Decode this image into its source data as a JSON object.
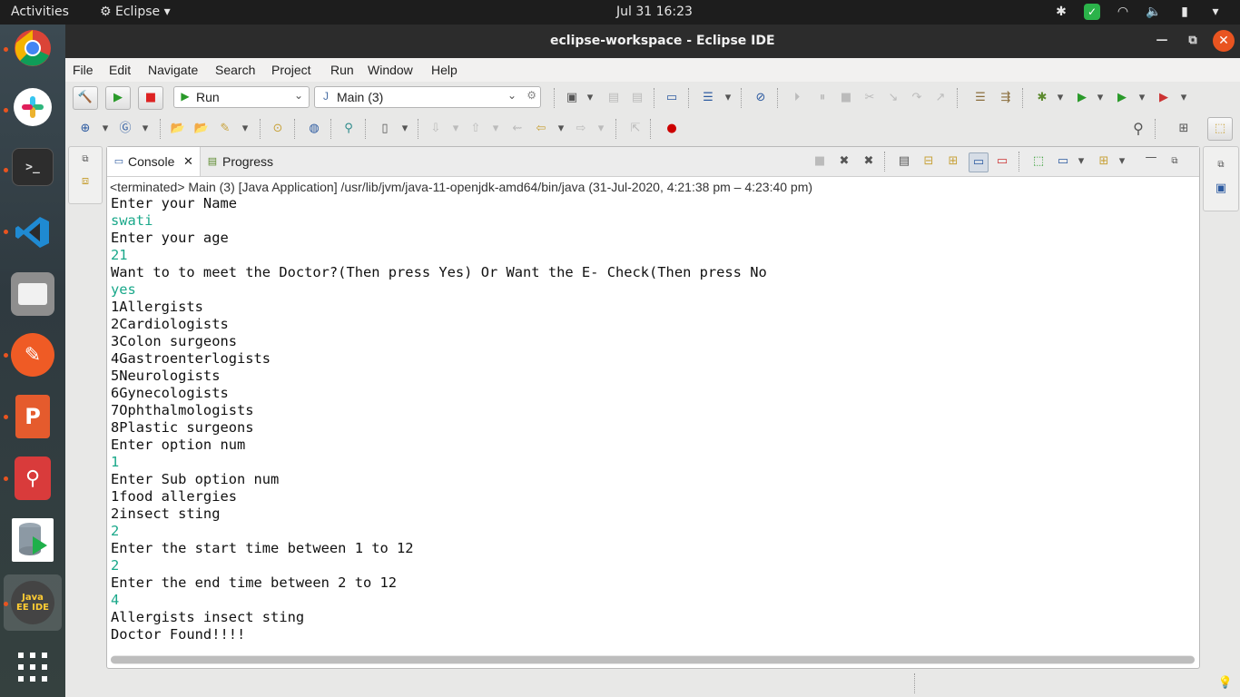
{
  "topbar": {
    "activities": "Activities",
    "app_menu": "Eclipse",
    "clock": "Jul 31  16:23"
  },
  "dock": {
    "apps": [
      "chrome",
      "slack",
      "terminal",
      "vscode",
      "files",
      "postman",
      "presentation",
      "wps",
      "database",
      "eclipse-javaee",
      "app-grid"
    ],
    "eclipse_label": "Java EE IDE"
  },
  "window": {
    "title": "eclipse-workspace - Eclipse IDE"
  },
  "menu": [
    "File",
    "Edit",
    "Navigate",
    "Search",
    "Project",
    "Run",
    "Window",
    "Help"
  ],
  "toolbar": {
    "run_combo": "Run",
    "config_combo": "Main (3)"
  },
  "view": {
    "tabs": [
      {
        "label": "Console",
        "active": true,
        "closable": true
      },
      {
        "label": "Progress",
        "active": false,
        "closable": false
      }
    ],
    "launch_info": "<terminated> Main (3) [Java Application] /usr/lib/jvm/java-11-openjdk-amd64/bin/java  (31-Jul-2020, 4:21:38 pm – 4:23:40 pm)",
    "console_lines": [
      {
        "text": "Enter your Name",
        "input": false
      },
      {
        "text": "swati",
        "input": true
      },
      {
        "text": "Enter your age",
        "input": false
      },
      {
        "text": "21",
        "input": true
      },
      {
        "text": "Want to to meet the Doctor?(Then press Yes) Or Want the E- Check(Then press No",
        "input": false
      },
      {
        "text": "yes",
        "input": true
      },
      {
        "text": "1Allergists",
        "input": false
      },
      {
        "text": "2Cardiologists",
        "input": false
      },
      {
        "text": "3Colon surgeons",
        "input": false
      },
      {
        "text": "4Gastroenterlogists",
        "input": false
      },
      {
        "text": "5Neurologists",
        "input": false
      },
      {
        "text": "6Gynecologists",
        "input": false
      },
      {
        "text": "7Ophthalmologists",
        "input": false
      },
      {
        "text": "8Plastic surgeons",
        "input": false
      },
      {
        "text": "Enter option num",
        "input": false
      },
      {
        "text": "1",
        "input": true
      },
      {
        "text": "Enter Sub option num",
        "input": false
      },
      {
        "text": "1food allergies",
        "input": false
      },
      {
        "text": "2insect sting",
        "input": false
      },
      {
        "text": "2",
        "input": true
      },
      {
        "text": "Enter the start time between 1 to 12",
        "input": false
      },
      {
        "text": "2",
        "input": true
      },
      {
        "text": "Enter the end time between 2 to 12",
        "input": false
      },
      {
        "text": "4",
        "input": true
      },
      {
        "text": "Allergists insect sting",
        "input": false
      },
      {
        "text": "Doctor Found!!!!",
        "input": false
      }
    ]
  },
  "colors": {
    "input_text": "#1aa88a",
    "ubuntu_orange": "#e95420"
  }
}
